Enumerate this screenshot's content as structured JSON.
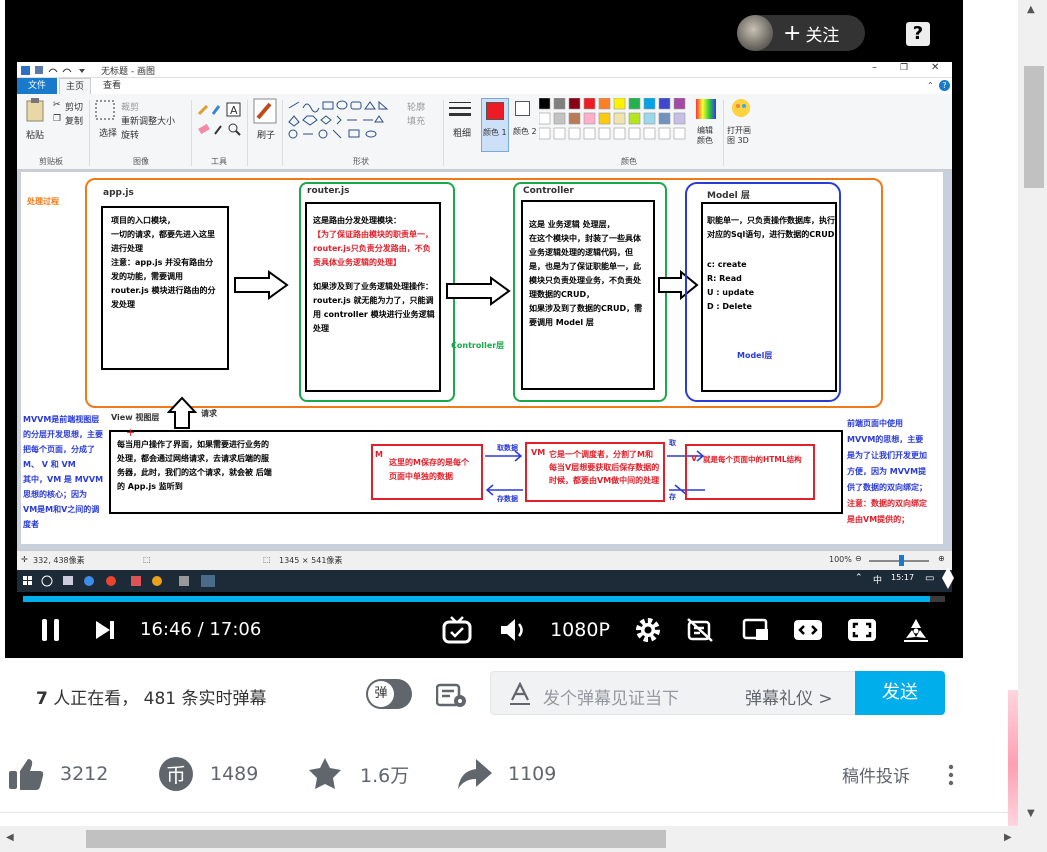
{
  "player": {
    "follow_label": "关注",
    "help_label": "?",
    "time_current": "16:46",
    "time_separator": "/",
    "time_total": "17:06",
    "quality": "1080P",
    "progress_fraction": 0.984
  },
  "paint": {
    "title": "无标题 - 画图",
    "tabs": [
      "文件",
      "主页",
      "查看"
    ],
    "ribbon": {
      "paste": "粘贴",
      "cut": "剪切",
      "copy": "复制",
      "clipboard_group": "剪贴板",
      "select": "选择",
      "crop": "裁剪",
      "resize": "重新调整大小",
      "rotate": "旋转",
      "image_group": "图像",
      "tools_group": "工具",
      "brushes": "刷子",
      "outline": "轮廓",
      "fill": "填充",
      "shapes_group": "形状",
      "size": "粗细",
      "color1": "颜色 1",
      "color2": "颜色 2",
      "edit_colors": "编辑颜色",
      "open_3d": "打开画图 3D",
      "colors_group": "颜色"
    },
    "status": {
      "cursor": "332, 438像素",
      "size": "1345 × 541像素",
      "zoom": "100%"
    },
    "taskbar_time": "15:17",
    "taskbar_ime": "中"
  },
  "diagram": {
    "process_label": "处理过程",
    "appjs_title": "app.js",
    "appjs_text": [
      "项目的入口模块，",
      "一切的请求，都要先进入这里",
      "进行处理",
      "注意：app.js 并没有路由分",
      "发的功能，需要调用",
      "router.js 模块进行路由的分",
      "发处理"
    ],
    "router_title": "router.js",
    "router_text_1": "这是路由分发处理模块：",
    "router_text_red": [
      "【为了保证路由模块的职责单一，",
      "router.js只负责分发路由，不负",
      "责具体业务逻辑的处理】"
    ],
    "router_text_2": [
      "如果涉及到了业务逻辑处理操作：",
      "router.js 就无能为力了，只能调",
      "用 controller 模块进行业务逻辑",
      "处理"
    ],
    "controller_title": "Controller",
    "controller_text": [
      "这是 业务逻辑 处理层，",
      "在这个模块中，封装了一些具体",
      "业务逻辑处理的逻辑代码，但",
      "是，也是为了保证职能单一，此",
      "模块只负责处理业务，不负责处",
      "理数据的CRUD，",
      "如果涉及到了数据的CRUD，需",
      "要调用 Model 层"
    ],
    "controller_layer": "Controller层",
    "model_title": "Model 层",
    "model_text": [
      "职能单一，只负责操作数据库，执行",
      "对应的Sql语句，进行数据的CRUD"
    ],
    "model_crud": [
      "c:  create",
      "R: Read",
      "U : update",
      "D : Delete"
    ],
    "model_layer": "Model层",
    "mvvm_left": [
      "MVVM是前端视图层",
      "的分层开发思想，主要",
      "把每个页面，分成了",
      "M、 V 和 VM",
      "其中，VM 是 MVVM",
      "思想的核心；因为",
      "VM是M和V之间的调",
      "度者"
    ],
    "view_title": "View 视图层",
    "request_label": "请求",
    "view_text": [
      "每当用户操作了界面，如果需要进行业务的",
      "处理，都会通过网络请求，去请求后端的服",
      "务器，此时，我们的这个请求，就会被 后端",
      "的 App.js 监听到"
    ],
    "m_label": "M",
    "m_text": [
      "这里的M保存的是每个",
      "页面中单独的数据"
    ],
    "fetch_data": "取数据",
    "store_data": "存数据",
    "vm_label": "VM",
    "vm_text": [
      "它是一个调度者，分割了M和",
      "每当V层想要获取后保存数据的",
      "时候，都要由VM做中间的处理"
    ],
    "v_label": "V",
    "get_label": "取",
    "save_label": "存",
    "v_text": "就是每个页面中的HTML结构",
    "mvvm_right": [
      "前端页面中使用",
      "MVVM的思想，主要",
      "是为了让我们开发更加",
      "方便，因为 MVVM提",
      "供了数据的双向绑定；"
    ],
    "mvvm_right_red": [
      "注意：数据的双向绑定",
      "是由VM提供的；"
    ]
  },
  "below": {
    "watching_count": "7",
    "watching_text": "人正在看，",
    "danmaku_count": "481",
    "danmaku_text": "条实时弹幕",
    "toggle_label": "弹",
    "input_placeholder": "发个弹幕见证当下",
    "etiquette": "弹幕礼仪 >",
    "send": "发送",
    "like_count": "3212",
    "coin_count": "1489",
    "fav_count": "1.6万",
    "share_count": "1109",
    "complaint": "稿件投诉"
  },
  "colors": {
    "accent": "#00aeec",
    "paint_blue": "#1979ca",
    "diagram_red": "#e0202a",
    "diagram_blue": "#2a3bd6",
    "diagram_green": "#1aa84a",
    "diagram_orange": "#f07a18"
  }
}
